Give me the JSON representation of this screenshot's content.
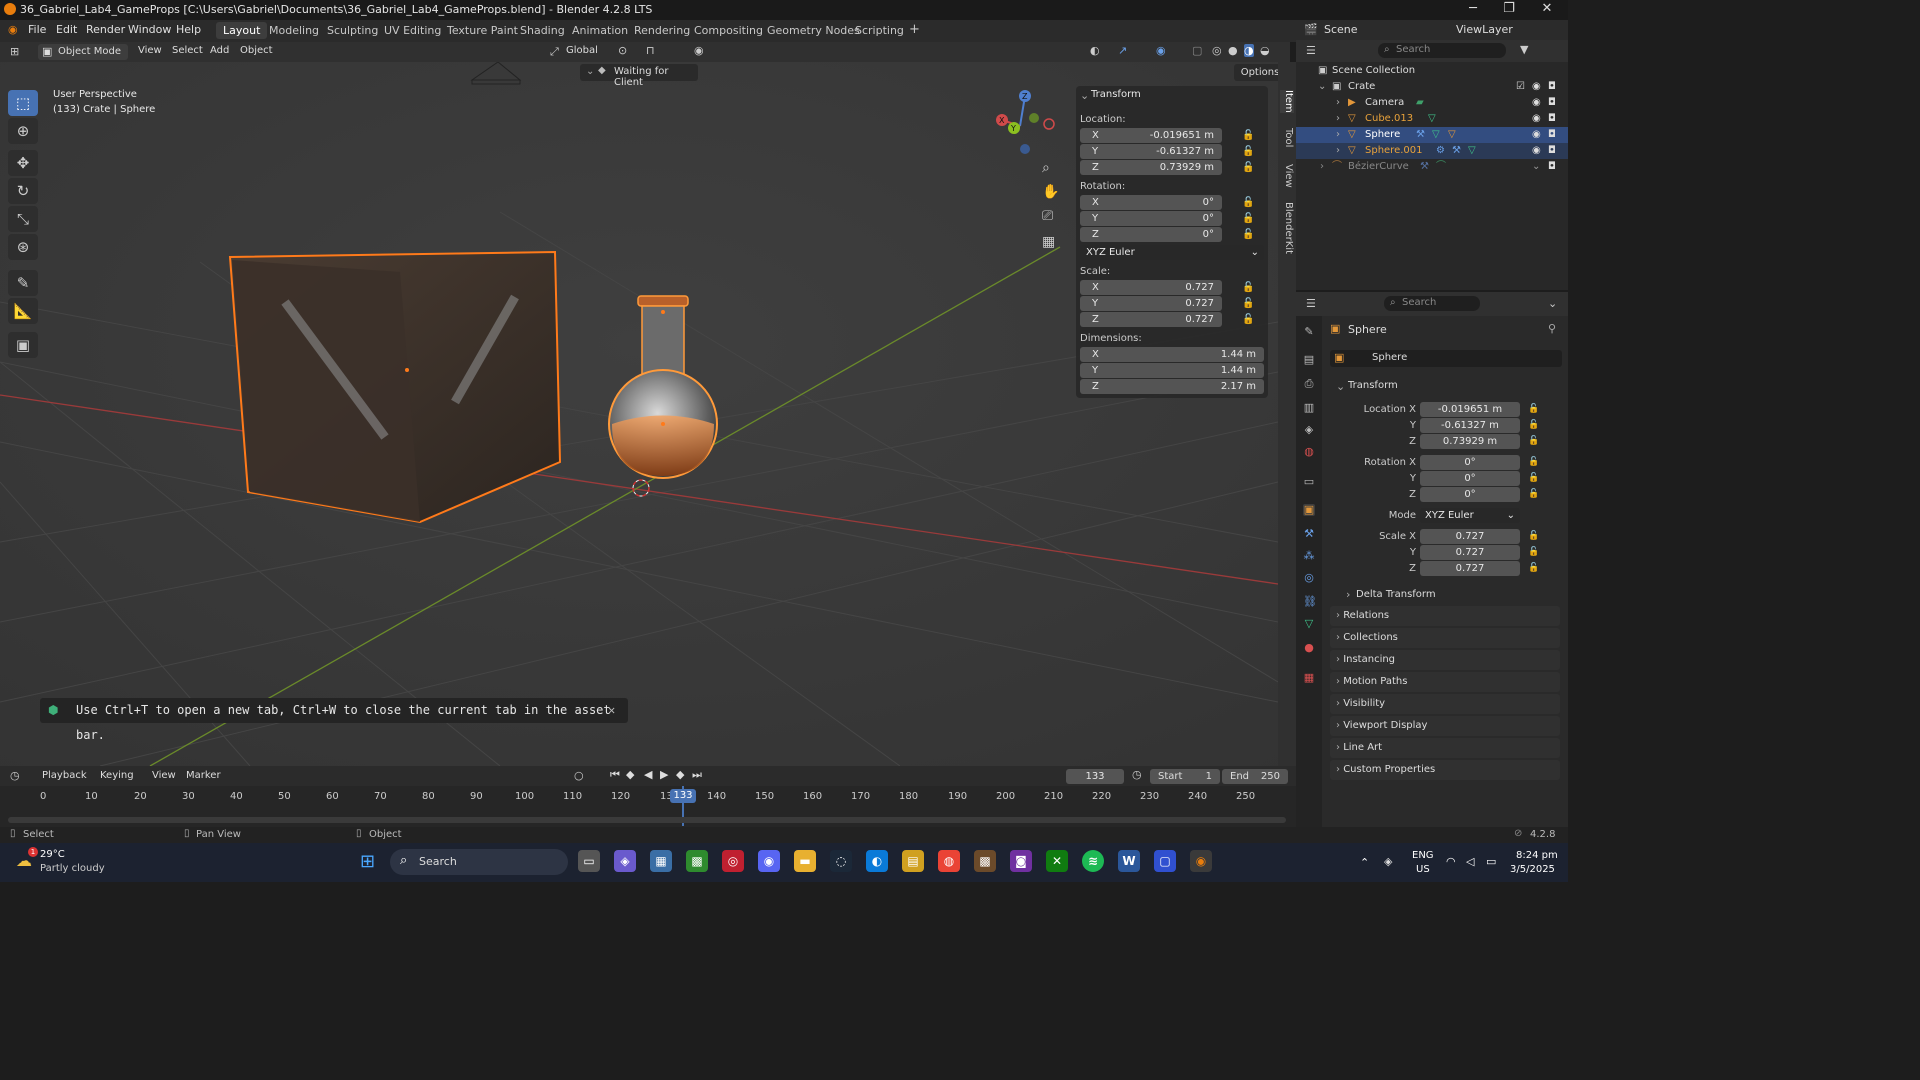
{
  "window": {
    "title": "36_Gabriel_Lab4_GameProps [C:\\Users\\Gabriel\\Documents\\36_Gabriel_Lab4_GameProps.blend] - Blender 4.2.8 LTS",
    "minimize": "─",
    "maximize": "❐",
    "close": "✕"
  },
  "menu": [
    "File",
    "Edit",
    "Render",
    "Window",
    "Help"
  ],
  "workspaces": [
    "Layout",
    "Modeling",
    "Sculpting",
    "UV Editing",
    "Texture Paint",
    "Shading",
    "Animation",
    "Rendering",
    "Compositing",
    "Geometry Nodes",
    "Scripting"
  ],
  "workspace_add": "+",
  "scene": {
    "label": "Scene",
    "view_layer": "ViewLayer"
  },
  "viewport_header": {
    "mode": "Object Mode",
    "menus": [
      "View",
      "Select",
      "Add",
      "Object"
    ],
    "orientation": "Global",
    "options": "Options"
  },
  "viewport": {
    "perspective": "User Perspective",
    "context": "(133) Crate | Sphere",
    "status_pill": "Waiting for Client",
    "gizmo": {
      "x": "X",
      "y": "Y",
      "z": "Z"
    }
  },
  "toast": {
    "text": "Use Ctrl+T to open a new tab, Ctrl+W to close the current tab in the asset bar.",
    "close": "✕"
  },
  "npanel": {
    "title": "Transform",
    "location_label": "Location:",
    "location": [
      {
        "axis": "X",
        "value": "-0.019651 m"
      },
      {
        "axis": "Y",
        "value": "-0.61327 m"
      },
      {
        "axis": "Z",
        "value": "0.73929 m"
      }
    ],
    "rotation_label": "Rotation:",
    "rotation": [
      {
        "axis": "X",
        "value": "0°"
      },
      {
        "axis": "Y",
        "value": "0°"
      },
      {
        "axis": "Z",
        "value": "0°"
      }
    ],
    "rotation_mode": "XYZ Euler",
    "scale_label": "Scale:",
    "scale": [
      {
        "axis": "X",
        "value": "0.727"
      },
      {
        "axis": "Y",
        "value": "0.727"
      },
      {
        "axis": "Z",
        "value": "0.727"
      }
    ],
    "dimensions_label": "Dimensions:",
    "dimensions": [
      {
        "axis": "X",
        "value": "1.44 m"
      },
      {
        "axis": "Y",
        "value": "1.44 m"
      },
      {
        "axis": "Z",
        "value": "2.17 m"
      }
    ],
    "tabs": [
      "Item",
      "Tool",
      "View",
      "BlenderKit"
    ]
  },
  "outliner": {
    "search_placeholder": "Search",
    "rows": [
      {
        "name": "Scene Collection",
        "indent": 0
      },
      {
        "name": "Crate",
        "indent": 1
      },
      {
        "name": "Camera",
        "indent": 2
      },
      {
        "name": "Cube.013",
        "indent": 2
      },
      {
        "name": "Sphere",
        "indent": 2
      },
      {
        "name": "Sphere.001",
        "indent": 2
      },
      {
        "name": "BézierCurve",
        "indent": 1
      }
    ]
  },
  "properties": {
    "search_placeholder": "Search",
    "object_name": "Sphere",
    "object_field": "Sphere",
    "transform_title": "Transform",
    "location": {
      "label_x": "Location X",
      "label_y": "Y",
      "label_z": "Z",
      "x": "-0.019651 m",
      "y": "-0.61327 m",
      "z": "0.73929 m"
    },
    "rotation": {
      "label_x": "Rotation X",
      "label_y": "Y",
      "label_z": "Z",
      "x": "0°",
      "y": "0°",
      "z": "0°"
    },
    "mode_label": "Mode",
    "mode_value": "XYZ Euler",
    "scale": {
      "label_x": "Scale X",
      "label_y": "Y",
      "label_z": "Z",
      "x": "0.727",
      "y": "0.727",
      "z": "0.727"
    },
    "delta": "Delta Transform",
    "sections": [
      "Relations",
      "Collections",
      "Instancing",
      "Motion Paths",
      "Visibility",
      "Viewport Display",
      "Line Art",
      "Custom Properties"
    ]
  },
  "timeline": {
    "menus": [
      "Playback",
      "Keying",
      "View",
      "Marker"
    ],
    "current_frame": "133",
    "start_label": "Start",
    "start": "1",
    "end_label": "End",
    "end": "250",
    "ticks": [
      "0",
      "10",
      "20",
      "30",
      "40",
      "50",
      "60",
      "70",
      "80",
      "90",
      "100",
      "110",
      "120",
      "13",
      "140",
      "150",
      "160",
      "170",
      "180",
      "190",
      "200",
      "210",
      "220",
      "230",
      "240",
      "250"
    ],
    "playhead": "133"
  },
  "statusbar": {
    "select": "Select",
    "pan": "Pan View",
    "object": "Object",
    "version": "4.2.8"
  },
  "taskbar": {
    "weather_temp": "29°C",
    "weather_desc": "Partly cloudy",
    "weather_badge": "1",
    "search": "Search",
    "lang": "ENG",
    "region": "US",
    "time": "8:24 pm",
    "date": "3/5/2025"
  }
}
